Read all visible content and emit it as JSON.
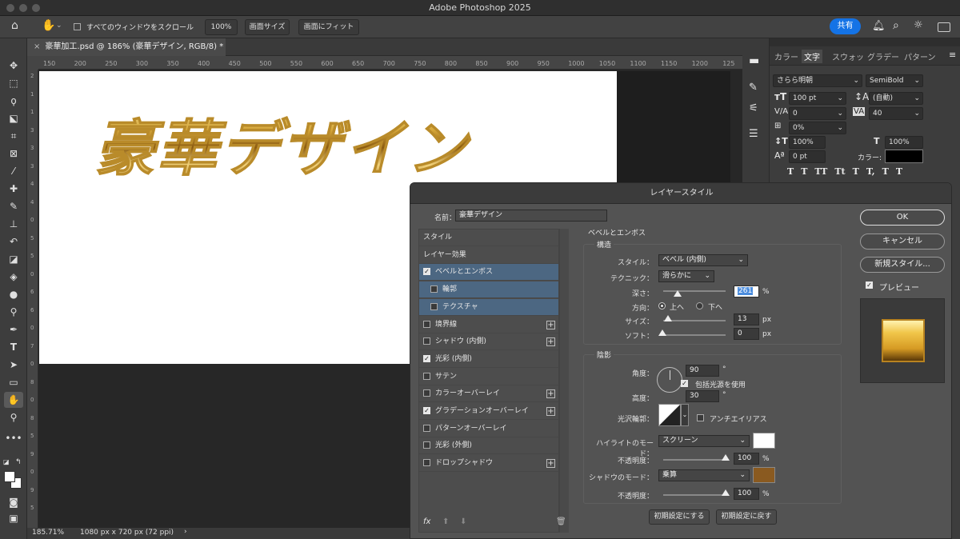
{
  "window": {
    "title": "Adobe Photoshop 2025"
  },
  "options": {
    "scroll_all_label": "すべてのウィンドウをスクロール",
    "zoom_btn": "100%",
    "fit_screen": "画面サイズ",
    "fill_screen": "画面にフィット",
    "share": "共有"
  },
  "document": {
    "tab": "豪華加工.psd @ 186% (豪華デザイン, RGB/8) *",
    "canvas_text": "豪華デザイン",
    "ruler_ticks": [
      "150",
      "200",
      "250",
      "300",
      "350",
      "400",
      "450",
      "500",
      "550",
      "600",
      "650",
      "700",
      "750",
      "800",
      "850",
      "900",
      "950",
      "1000",
      "1050",
      "1100",
      "1150",
      "1200",
      "125"
    ],
    "vruler": [
      "2",
      "1",
      "1",
      "3",
      "3",
      "3",
      "4",
      "4",
      "0",
      "5",
      "5",
      "0",
      "6",
      "6",
      "0",
      "7",
      "0",
      "8",
      "0",
      "8",
      "5",
      "9",
      "0",
      "9",
      "5"
    ]
  },
  "status": {
    "zoom": "185.71%",
    "size": "1080 px x 720 px (72 ppi)",
    "arrow": "›"
  },
  "panel": {
    "tabs": [
      "カラー",
      "文字",
      "スウォッ",
      "グラデー",
      "パターン"
    ],
    "font_family": "さらら明朝",
    "font_style": "SemiBold",
    "font_size": "100 pt",
    "leading": "(自動)",
    "kerning": "0",
    "tracking": "40",
    "scale_pct": "0%",
    "vscale": "100%",
    "hscale": "100%",
    "baseline": "0 pt",
    "color_label": "カラー:",
    "style_buttons": [
      "T",
      "T",
      "TT",
      "Tt",
      "T",
      "T,",
      "T",
      "T"
    ]
  },
  "dialog": {
    "title": "レイヤースタイル",
    "name_label": "名前：",
    "name_value": "豪華デザイン",
    "list": [
      {
        "label": "スタイル",
        "cb": null,
        "plus": false,
        "sel": false
      },
      {
        "label": "レイヤー効果",
        "cb": null,
        "plus": false,
        "sel": false
      },
      {
        "label": "ベベルとエンボス",
        "cb": true,
        "plus": false,
        "sel": true
      },
      {
        "label": "輪郭",
        "cb": false,
        "plus": false,
        "sel": true,
        "indent": true
      },
      {
        "label": "テクスチャ",
        "cb": false,
        "plus": false,
        "sel": true,
        "indent": true
      },
      {
        "label": "境界線",
        "cb": false,
        "plus": true,
        "sel": false
      },
      {
        "label": "シャドウ (内側)",
        "cb": false,
        "plus": true,
        "sel": false
      },
      {
        "label": "光彩 (内側)",
        "cb": true,
        "plus": false,
        "sel": false
      },
      {
        "label": "サテン",
        "cb": false,
        "plus": false,
        "sel": false
      },
      {
        "label": "カラーオーバーレイ",
        "cb": false,
        "plus": true,
        "sel": false
      },
      {
        "label": "グラデーションオーバーレイ",
        "cb": true,
        "plus": true,
        "sel": false
      },
      {
        "label": "パターンオーバーレイ",
        "cb": false,
        "plus": false,
        "sel": false
      },
      {
        "label": "光彩 (外側)",
        "cb": false,
        "plus": false,
        "sel": false
      },
      {
        "label": "ドロップシャドウ",
        "cb": false,
        "plus": true,
        "sel": false
      }
    ],
    "fx": "fx",
    "section_title": "ベベルとエンボス",
    "struct_title": "構造",
    "style_label": "スタイル：",
    "style_value": "ベベル (内側)",
    "technique_label": "テクニック：",
    "technique_value": "滑らかに",
    "depth_label": "深さ：",
    "depth_value": "261",
    "depth_unit": "%",
    "direction_label": "方向：",
    "dir_up": "上へ",
    "dir_down": "下へ",
    "size_label": "サイズ：",
    "size_value": "13",
    "size_unit": "px",
    "soften_label": "ソフト：",
    "soften_value": "0",
    "soften_unit": "px",
    "shade_title": "陰影",
    "angle_label": "角度：",
    "angle_value": "90",
    "deg": "°",
    "global_light": "包括光源を使用",
    "altitude_label": "高度：",
    "altitude_value": "30",
    "gloss_label": "光沢輪郭：",
    "antialias": "アンチエイリアス",
    "hl_mode_label": "ハイライトのモード：",
    "hl_mode": "スクリーン",
    "hl_opacity_label": "不透明度：",
    "hl_opacity": "100",
    "pct": "%",
    "sh_mode_label": "シャドウのモード：",
    "sh_mode": "乗算",
    "sh_opacity_label": "不透明度：",
    "sh_opacity": "100",
    "default_make": "初期設定にする",
    "default_reset": "初期設定に戻す",
    "ok": "OK",
    "cancel": "キャンセル",
    "new_style": "新規スタイル...",
    "preview": "プレビュー",
    "highlight_color": "#ffffff",
    "shadow_color": "#8a5a20"
  }
}
